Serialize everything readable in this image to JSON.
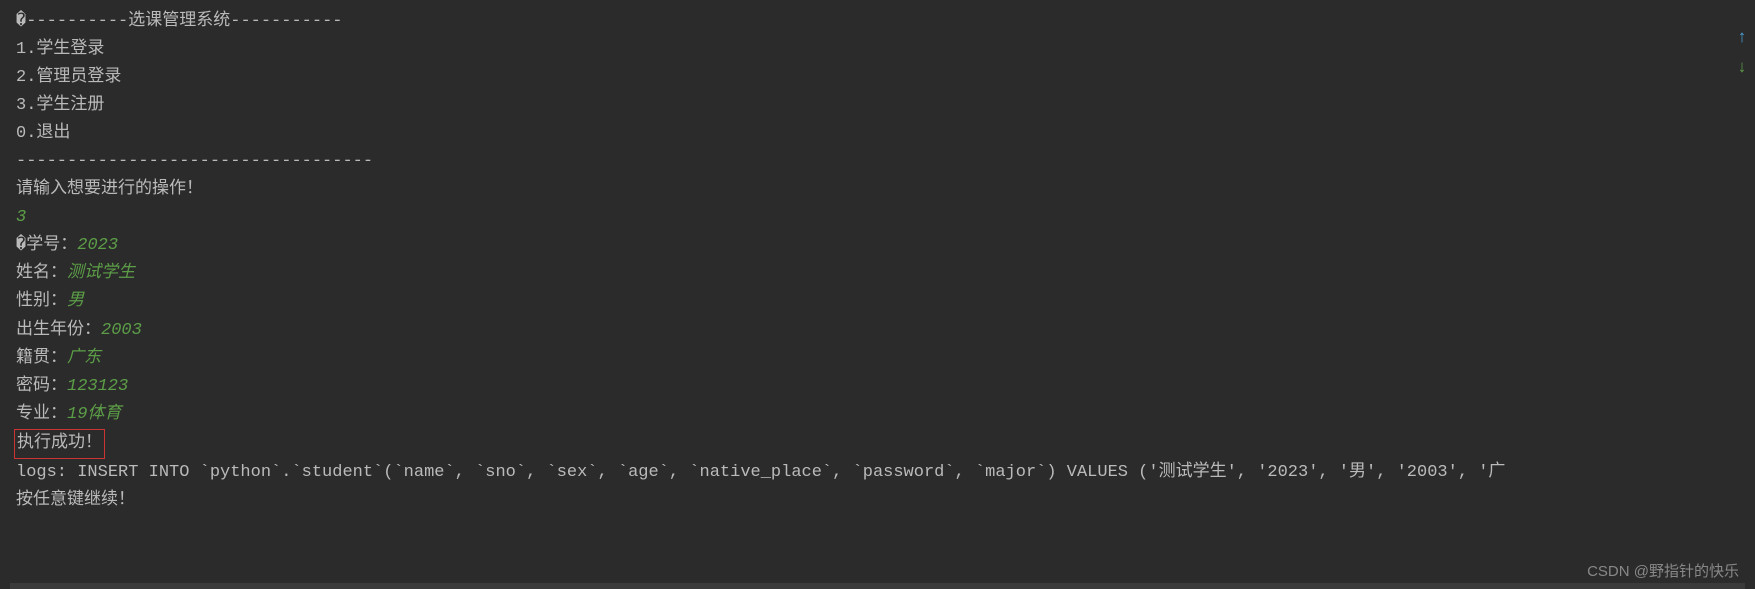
{
  "header": "�----------选课管理系统-----------",
  "menu": {
    "item1": "1.学生登录",
    "item2": "2.管理员登录",
    "item3": "3.学生注册",
    "item0": "0.退出"
  },
  "divider": "-----------------------------------",
  "prompt": "请输入想要进行的操作！",
  "inputChoice": "3",
  "fields": {
    "sno": {
      "label": "�学号：",
      "value": "2023"
    },
    "name": {
      "label": "姓名：",
      "value": "测试学生"
    },
    "sex": {
      "label": "性别：",
      "value": "男"
    },
    "birth": {
      "label": "出生年份：",
      "value": "2003"
    },
    "native": {
      "label": "籍贯：",
      "value": "广东"
    },
    "password": {
      "label": "密码：",
      "value": "123123"
    },
    "major": {
      "label": "专业：",
      "value": "19体育"
    }
  },
  "successMsg": "执行成功！",
  "logLine": "logs: INSERT INTO `python`.`student`(`name`, `sno`, `sex`, `age`, `native_place`, `password`, `major`) VALUES ('测试学生', '2023', '男', '2003', '广",
  "continueMsg": "按任意键继续！",
  "watermark": "CSDN @野指针的快乐"
}
